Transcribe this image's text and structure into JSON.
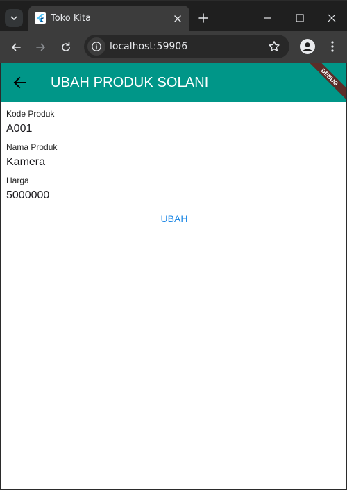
{
  "browser": {
    "tab_title": "Toko Kita",
    "url": "localhost:59906",
    "icons": [
      "tab-search-icon",
      "flutter-favicon-icon",
      "close-icon",
      "plus-icon",
      "minimize-icon",
      "maximize-icon",
      "close-window-icon",
      "back-arrow-icon",
      "forward-arrow-icon",
      "reload-icon",
      "site-info-icon",
      "star-icon",
      "profile-icon",
      "more-vert-icon"
    ]
  },
  "app": {
    "title": "UBAH PRODUK SOLANI",
    "debug_banner": "DEBUG",
    "appbar_color": "#009688",
    "accent_color": "#1e88e5"
  },
  "form": {
    "fields": [
      {
        "label": "Kode Produk",
        "value": "A001"
      },
      {
        "label": "Nama Produk",
        "value": "Kamera"
      },
      {
        "label": "Harga",
        "value": "5000000"
      }
    ],
    "submit_label": "UBAH"
  }
}
